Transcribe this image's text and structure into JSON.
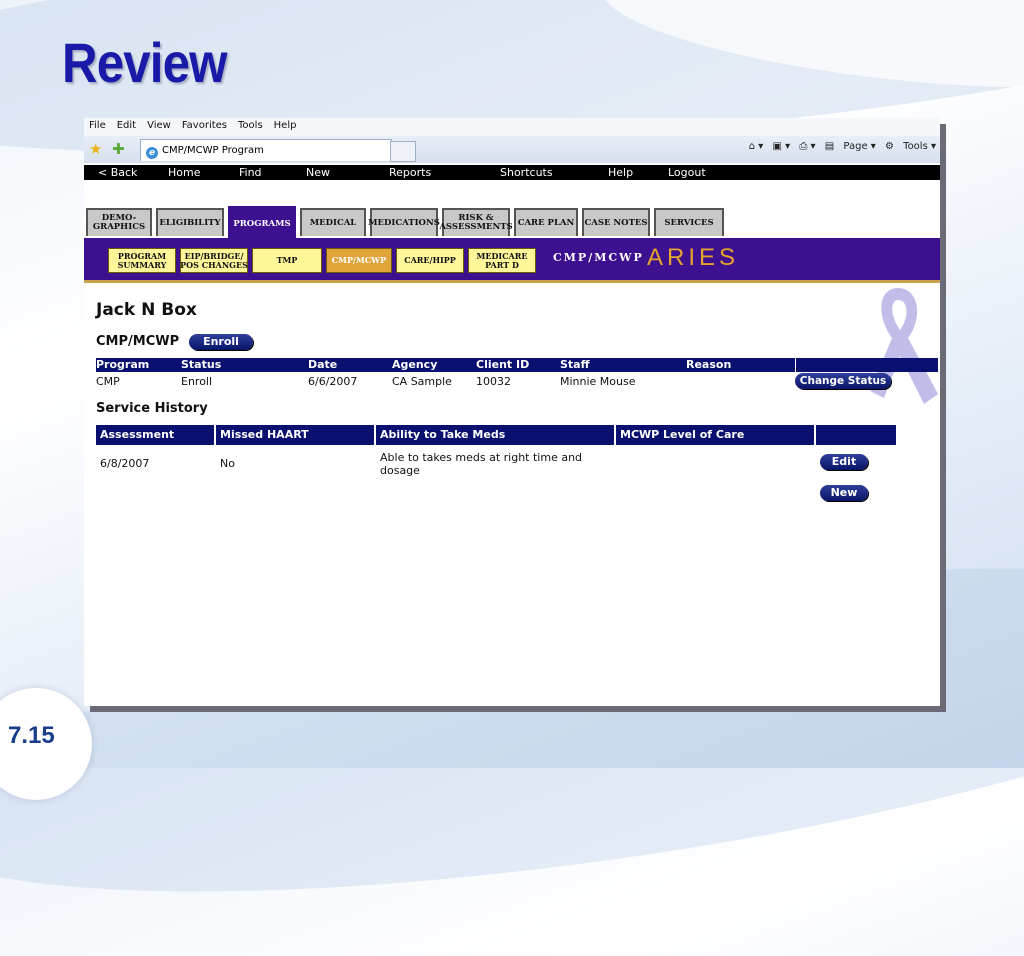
{
  "slide": {
    "title": "Review",
    "number": "7.15"
  },
  "browser": {
    "menu": [
      "File",
      "Edit",
      "View",
      "Favorites",
      "Tools",
      "Help"
    ],
    "tab_title": "CMP/MCWP Program",
    "page_label": "Page",
    "tools_label": "Tools"
  },
  "app_nav": [
    "< Back",
    "Home",
    "Find",
    "New",
    "Reports",
    "Shortcuts",
    "Help",
    "Logout"
  ],
  "main_tabs": [
    "DEMO-\nGRAPHICS",
    "ELIGIBILITY",
    "PROGRAMS",
    "MEDICAL",
    "MEDICATIONS",
    "RISK &\nASSESSMENTS",
    "CARE PLAN",
    "CASE NOTES",
    "SERVICES"
  ],
  "sub_tabs": [
    "PROGRAM\nSUMMARY",
    "EIP/BRIDGE/\nPOS CHANGES",
    "TMP",
    "CMP/MCWP",
    "CARE/HIPP",
    "MEDICARE\nPART D"
  ],
  "brand": {
    "prefix": "CMP/MCWP",
    "logo": "ARIES"
  },
  "client": {
    "name": "Jack N Box"
  },
  "program_section": {
    "title": "CMP/MCWP",
    "enroll_label": "Enroll",
    "columns": [
      "Program",
      "Status",
      "Date",
      "Agency",
      "Client ID",
      "Staff",
      "Reason"
    ],
    "row": [
      "CMP",
      "Enroll",
      "6/6/2007",
      "CA Sample",
      "10032",
      "Minnie Mouse",
      ""
    ],
    "change_status_label": "Change Status"
  },
  "service_history": {
    "title": "Service History",
    "columns": [
      "Assessment",
      "Missed HAART",
      "Ability to Take Meds",
      "MCWP Level of Care"
    ],
    "row": [
      "6/8/2007",
      "No",
      "Able to takes meds at right time and dosage",
      ""
    ],
    "edit_label": "Edit",
    "new_label": "New"
  }
}
